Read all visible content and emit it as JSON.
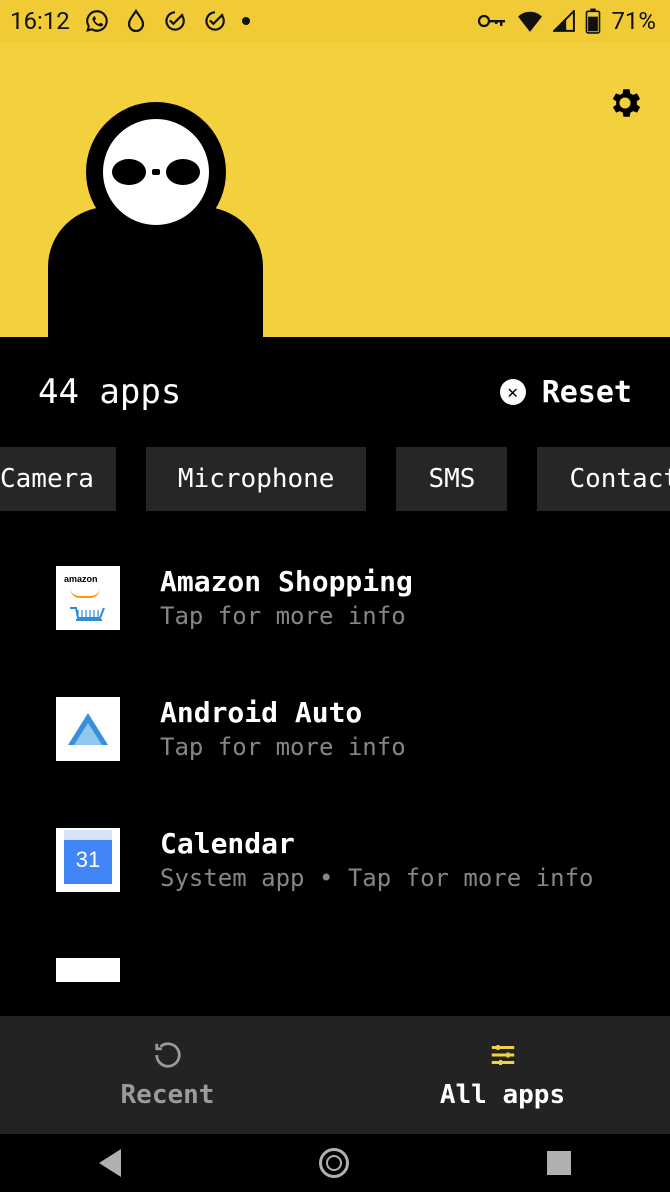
{
  "status": {
    "time": "16:12",
    "battery": "71%"
  },
  "header": {
    "apps_count_label": "44 apps",
    "reset_label": "Reset"
  },
  "chips": [
    "Camera",
    "Microphone",
    "SMS",
    "Contacts"
  ],
  "apps": [
    {
      "name": "Amazon Shopping",
      "sub": "Tap for more info",
      "icon": "amazon"
    },
    {
      "name": "Android Auto",
      "sub": "Tap for more info",
      "icon": "android-auto"
    },
    {
      "name": "Calendar",
      "sub": "System app • Tap for more info",
      "icon": "calendar",
      "day": "31"
    }
  ],
  "tabs": {
    "recent": "Recent",
    "all_apps": "All apps"
  }
}
